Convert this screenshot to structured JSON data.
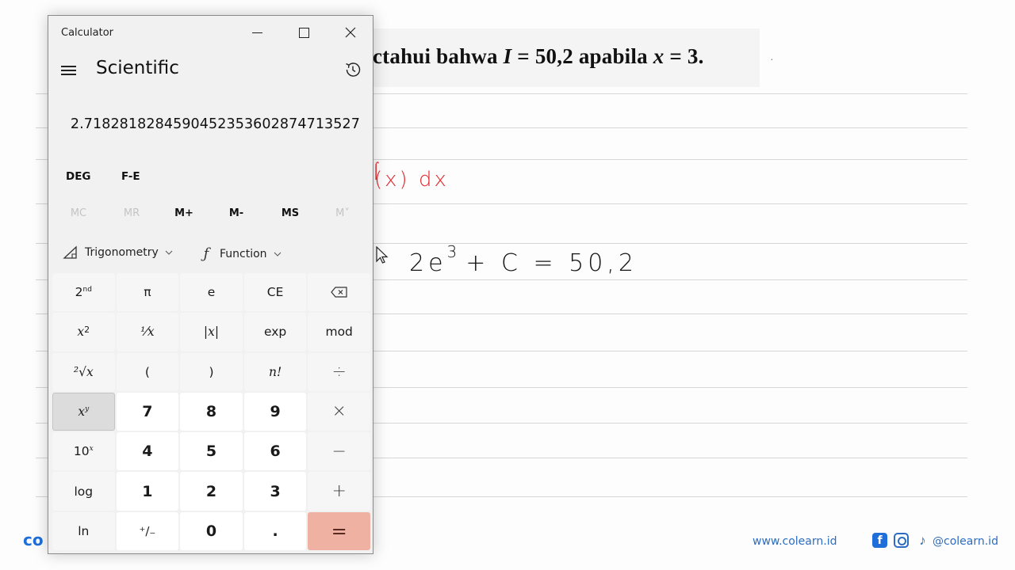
{
  "background": {
    "typed_problem": {
      "prefix": "ctahui bahwa ",
      "var_I": "I",
      "mid1": " = 50,2 apabila ",
      "var_x": "x",
      "suffix": " = 3."
    },
    "dot": "·",
    "handwriting_red": "(x) dx",
    "handwriting_red_hook": "⌠",
    "handwriting_black": {
      "base": "2e",
      "exponent": "3",
      "rest": "+ C = 50,2"
    },
    "brand_left": "co",
    "footer": {
      "url": "www.colearn.id",
      "facebook_glyph": "f",
      "tiktok_glyph": "♪",
      "handle": "@colearn.id"
    },
    "colors": {
      "handwriting_red": "#e2262a",
      "brand_blue": "#1e6fd9",
      "equals_key": "#efb2a2"
    }
  },
  "calculator": {
    "window_title": "Calculator",
    "mode_title": "Scientific",
    "display_value": "2.718281828459045235360287471352 7",
    "angle_mode": "DEG",
    "fe_label": "F-E",
    "memory": [
      {
        "label": "MC",
        "enabled": false
      },
      {
        "label": "MR",
        "enabled": false
      },
      {
        "label": "M+",
        "enabled": true
      },
      {
        "label": "M-",
        "enabled": true
      },
      {
        "label": "MS",
        "enabled": true
      },
      {
        "label": "M˅",
        "enabled": false
      }
    ],
    "dropdowns": {
      "trigonometry": "Trigonometry",
      "function": "Function"
    },
    "keys": {
      "second": {
        "base": "2",
        "sup": "nd"
      },
      "pi": "π",
      "e": "e",
      "ce": "CE",
      "x_squared": {
        "base": "x",
        "sup": "2"
      },
      "reciprocal": "⅟x",
      "abs": "|x|",
      "exp": "exp",
      "mod": "mod",
      "sqrt": "²√x",
      "lparen": "(",
      "rparen": ")",
      "factorial": "n!",
      "divide": "÷",
      "x_pow_y": {
        "base": "x",
        "sup": "y"
      },
      "seven": "7",
      "eight": "8",
      "nine": "9",
      "multiply": "×",
      "ten_pow_x": {
        "base": "10",
        "sup": "x"
      },
      "four": "4",
      "five": "5",
      "six": "6",
      "minus": "−",
      "log": "log",
      "one": "1",
      "two": "2",
      "three": "3",
      "plus": "+",
      "ln": "ln",
      "negate": "⁺∕₋",
      "zero": "0",
      "decimal": ".",
      "equals": "="
    }
  }
}
